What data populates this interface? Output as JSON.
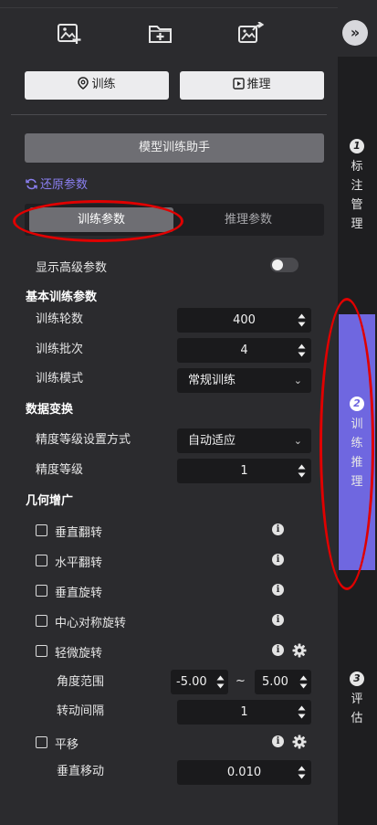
{
  "toolbar": {
    "icons": [
      "add-image-icon",
      "add-folder-icon",
      "export-image-icon"
    ]
  },
  "mode_buttons": {
    "train": "训练",
    "infer": "推理"
  },
  "assistant_button": "模型训练助手",
  "reset_link": "还原参数",
  "tabs": {
    "train_params": "训练参数",
    "infer_params": "推理参数",
    "active": "训练参数"
  },
  "show_advanced": {
    "label": "显示高级参数",
    "on": false
  },
  "basic": {
    "title": "基本训练参数",
    "epochs": {
      "label": "训练轮数",
      "value": "400"
    },
    "batch": {
      "label": "训练批次",
      "value": "4"
    },
    "mode": {
      "label": "训练模式",
      "value": "常规训练"
    }
  },
  "transform": {
    "title": "数据变换",
    "precision_method": {
      "label": "精度等级设置方式",
      "value": "自动适应"
    },
    "precision_level": {
      "label": "精度等级",
      "value": "1"
    }
  },
  "augment": {
    "title": "几何增广",
    "vflip": "垂直翻转",
    "hflip": "水平翻转",
    "vrotate": "垂直旋转",
    "center_rotate": "中心对称旋转",
    "slight_rotate": "轻微旋转",
    "angle_range": {
      "label": "角度范围",
      "min": "-5.00",
      "sep": "~",
      "max": "5.00"
    },
    "rotate_interval": {
      "label": "转动间隔",
      "value": "1"
    },
    "translate": "平移",
    "vertical_move": {
      "label": "垂直移动",
      "value": "0.010"
    }
  },
  "steps": [
    {
      "num": "1",
      "label": "标注管理"
    },
    {
      "num": "2",
      "label": "训练推理",
      "active": true
    },
    {
      "num": "3",
      "label": "评估"
    }
  ],
  "colors": {
    "accent": "#6f67e0",
    "annotation": "#e00000",
    "panel": "#2b2b2e"
  }
}
